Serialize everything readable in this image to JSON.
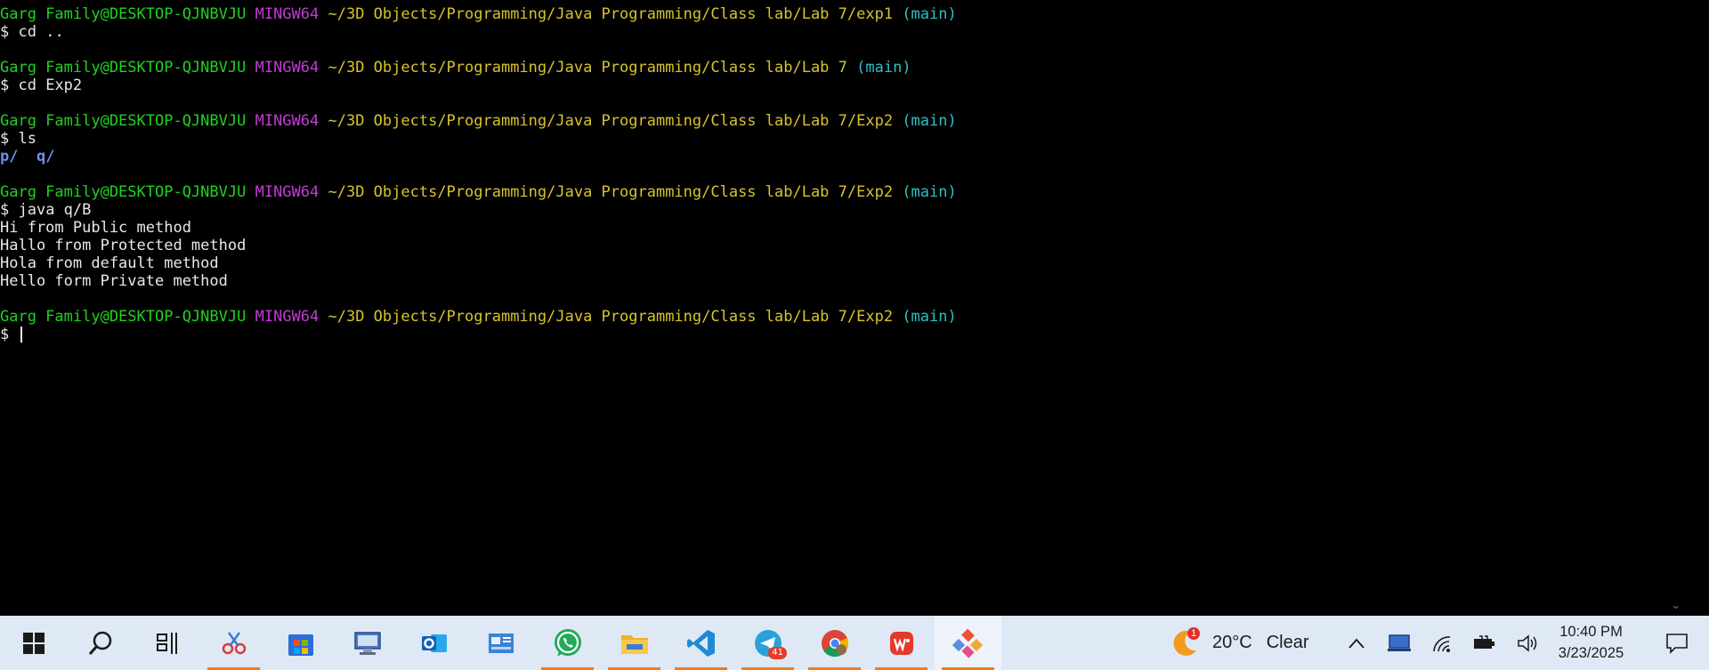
{
  "terminal": {
    "lines": [
      {
        "user": "Garg Family@DESKTOP-QJNBVJU",
        "shell": "MINGW64",
        "path": "~/3D Objects/Programming/Java Programming/Class lab/Lab 7/exp1",
        "branch": "(main)"
      },
      {
        "prompt": "$",
        "cmd": "cd .."
      },
      {
        "blank": ""
      },
      {
        "user": "Garg Family@DESKTOP-QJNBVJU",
        "shell": "MINGW64",
        "path": "~/3D Objects/Programming/Java Programming/Class lab/Lab 7",
        "branch": "(main)"
      },
      {
        "prompt": "$",
        "cmd": "cd Exp2"
      },
      {
        "blank": ""
      },
      {
        "user": "Garg Family@DESKTOP-QJNBVJU",
        "shell": "MINGW64",
        "path": "~/3D Objects/Programming/Java Programming/Class lab/Lab 7/Exp2",
        "branch": "(main)"
      },
      {
        "prompt": "$",
        "cmd": "ls"
      },
      {
        "dir1": "p/",
        "dir2": "q/"
      },
      {
        "blank": ""
      },
      {
        "user": "Garg Family@DESKTOP-QJNBVJU",
        "shell": "MINGW64",
        "path": "~/3D Objects/Programming/Java Programming/Class lab/Lab 7/Exp2",
        "branch": "(main)"
      },
      {
        "prompt": "$",
        "cmd": "java q/B"
      },
      {
        "out": "Hi from Public method"
      },
      {
        "out": "Hallo from Protected method"
      },
      {
        "out": "Hola from default method"
      },
      {
        "out": "Hello form Private method"
      },
      {
        "blank": ""
      },
      {
        "user": "Garg Family@DESKTOP-QJNBVJU",
        "shell": "MINGW64",
        "path": "~/3D Objects/Programming/Java Programming/Class lab/Lab 7/Exp2",
        "branch": "(main)"
      },
      {
        "prompt": "$",
        "cmd": ""
      }
    ]
  },
  "taskbar": {
    "apps": [
      {
        "icon": "windows-start-icon",
        "active": false,
        "running": false
      },
      {
        "icon": "search-icon",
        "active": false,
        "running": false
      },
      {
        "icon": "task-view-icon",
        "active": false,
        "running": false
      },
      {
        "icon": "snipping-tool-icon",
        "active": false,
        "running": true
      },
      {
        "icon": "microsoft-store-icon",
        "active": false,
        "running": false
      },
      {
        "icon": "file-explorer-desktop-icon",
        "active": false,
        "running": false
      },
      {
        "icon": "outlook-icon",
        "active": false,
        "running": false
      },
      {
        "icon": "control-panel-icon",
        "active": false,
        "running": false
      },
      {
        "icon": "whatsapp-icon",
        "active": false,
        "running": true
      },
      {
        "icon": "folder-icon",
        "active": false,
        "running": true
      },
      {
        "icon": "vscode-icon",
        "active": false,
        "running": true
      },
      {
        "icon": "telegram-icon",
        "active": false,
        "running": true,
        "badge": "41"
      },
      {
        "icon": "chrome-icon",
        "active": false,
        "running": true
      },
      {
        "icon": "wps-office-icon",
        "active": false,
        "running": true
      },
      {
        "icon": "git-bash-icon",
        "active": true,
        "running": true
      }
    ],
    "weather": {
      "icon": "moon-weather-icon",
      "badge": "1",
      "temp": "20°C",
      "condition": "Clear"
    },
    "tray": [
      "chevron-up-icon",
      "tablet-icon",
      "wifi-icon",
      "battery-icon",
      "volume-icon"
    ],
    "clock": {
      "time": "10:40 PM",
      "date": "3/23/2025"
    },
    "notification_icon": "notification-icon"
  },
  "colors": {
    "user": "#1fd31f",
    "shell": "#c33ad6",
    "path": "#d8c32b",
    "branch": "#2ec0c9",
    "dir": "#6f8df0",
    "taskbar_bg": "#dfe8f5",
    "active_indicator": "#f07a23"
  }
}
